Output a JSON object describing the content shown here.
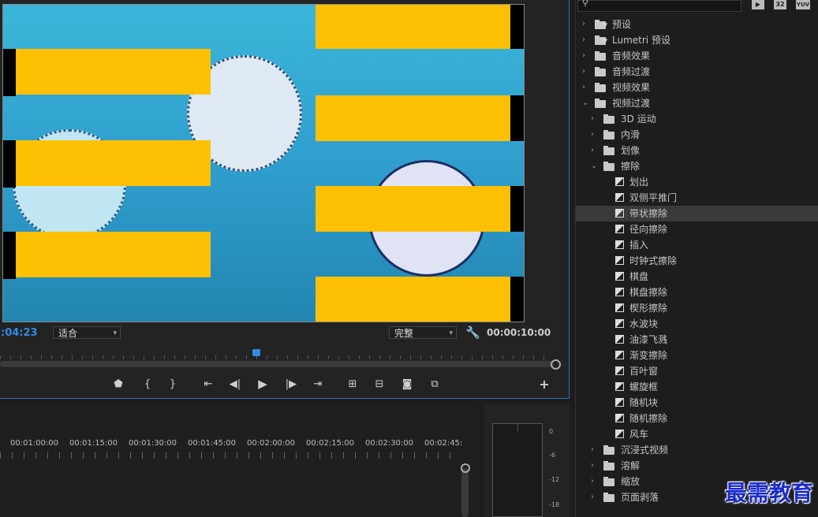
{
  "monitor": {
    "current_time": ":04:23",
    "fit_label": "适合",
    "quality_label": "完整",
    "duration": "00:00:10:00"
  },
  "transport": {
    "icons": [
      "marker-icon",
      "mark-in-icon",
      "mark-out-icon",
      "go-to-in-icon",
      "step-back-icon",
      "play-icon",
      "step-forward-icon",
      "go-to-out-icon",
      "lift-icon",
      "extract-icon",
      "camera-icon",
      "compare-icon",
      "add-icon"
    ]
  },
  "timeline": {
    "ruler": [
      "00:01:00:00",
      "00:01:15:00",
      "00:01:30:00",
      "00:01:45:00",
      "00:02:00:00",
      "00:02:15:00",
      "00:02:30:00",
      "00:02:45:"
    ]
  },
  "meter": {
    "scale": [
      "0",
      "-6",
      "-12",
      "-18"
    ]
  },
  "effects": {
    "badges": [
      "32",
      "YUV"
    ],
    "items": [
      {
        "label": "预设",
        "level": 0,
        "type": "folder-star",
        "open": false
      },
      {
        "label": "Lumetri 预设",
        "level": 0,
        "type": "folder-star",
        "open": false
      },
      {
        "label": "音频效果",
        "level": 0,
        "type": "folder",
        "open": false
      },
      {
        "label": "音频过渡",
        "level": 0,
        "type": "folder",
        "open": false
      },
      {
        "label": "视频效果",
        "level": 0,
        "type": "folder",
        "open": false
      },
      {
        "label": "视频过渡",
        "level": 0,
        "type": "folder",
        "open": true
      },
      {
        "label": "3D 运动",
        "level": 1,
        "type": "folder",
        "open": false
      },
      {
        "label": "内滑",
        "level": 1,
        "type": "folder",
        "open": false
      },
      {
        "label": "划像",
        "level": 1,
        "type": "folder",
        "open": false
      },
      {
        "label": "擦除",
        "level": 1,
        "type": "folder",
        "open": true
      },
      {
        "label": "划出",
        "level": 2,
        "type": "fx"
      },
      {
        "label": "双侧平推门",
        "level": 2,
        "type": "fx"
      },
      {
        "label": "带状擦除",
        "level": 2,
        "type": "fx",
        "selected": true
      },
      {
        "label": "径向擦除",
        "level": 2,
        "type": "fx"
      },
      {
        "label": "插入",
        "level": 2,
        "type": "fx"
      },
      {
        "label": "时钟式擦除",
        "level": 2,
        "type": "fx"
      },
      {
        "label": "棋盘",
        "level": 2,
        "type": "fx"
      },
      {
        "label": "棋盘擦除",
        "level": 2,
        "type": "fx"
      },
      {
        "label": "楔形擦除",
        "level": 2,
        "type": "fx"
      },
      {
        "label": "水波块",
        "level": 2,
        "type": "fx"
      },
      {
        "label": "油漆飞溅",
        "level": 2,
        "type": "fx"
      },
      {
        "label": "渐变擦除",
        "level": 2,
        "type": "fx"
      },
      {
        "label": "百叶窗",
        "level": 2,
        "type": "fx"
      },
      {
        "label": "螺旋框",
        "level": 2,
        "type": "fx"
      },
      {
        "label": "随机块",
        "level": 2,
        "type": "fx"
      },
      {
        "label": "随机擦除",
        "level": 2,
        "type": "fx"
      },
      {
        "label": "风车",
        "level": 2,
        "type": "fx"
      },
      {
        "label": "沉浸式视频",
        "level": 1,
        "type": "folder",
        "open": false
      },
      {
        "label": "溶解",
        "level": 1,
        "type": "folder",
        "open": false
      },
      {
        "label": "缩放",
        "level": 1,
        "type": "folder",
        "open": false
      },
      {
        "label": "页面剥落",
        "level": 1,
        "type": "folder",
        "open": false
      }
    ]
  },
  "watermark": "最需教育",
  "colors": {
    "accent": "#2f8de4",
    "wipe_bar": "#fec003",
    "selected_row": "#3a3a3a"
  }
}
